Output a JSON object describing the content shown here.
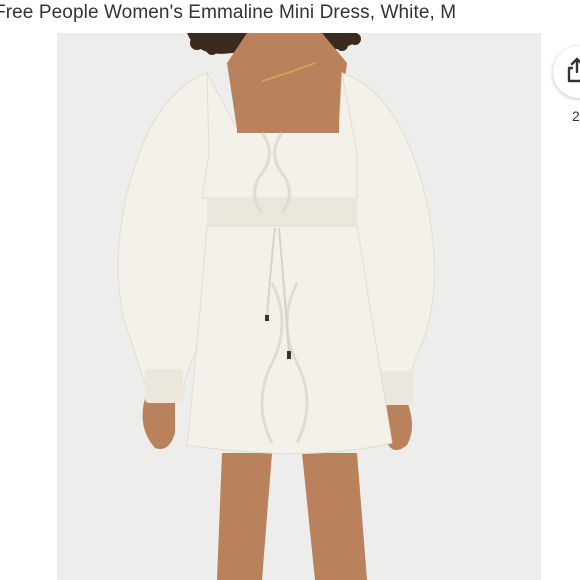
{
  "listing": {
    "title": "Free People Women's Emmaline Mini Dress, White, M",
    "share_count": "2"
  },
  "icons": {
    "share": "share-icon"
  },
  "colors": {
    "background": "#ffffff",
    "photo_backdrop": "#ededeb",
    "dress": "#f3f1ea",
    "skin": "#b9825d",
    "hair": "#3b2a1e",
    "text": "#333333"
  }
}
